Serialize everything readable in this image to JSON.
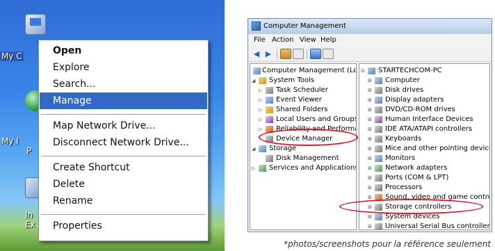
{
  "desktop": {
    "labels": [
      "My C",
      "My I",
      "P",
      "In",
      "Ex"
    ]
  },
  "context_menu": {
    "items": [
      "Open",
      "Explore",
      "Search...",
      "Manage",
      "Map Network Drive...",
      "Disconnect Network Drive...",
      "Create Shortcut",
      "Delete",
      "Rename",
      "Properties"
    ],
    "highlighted": "Manage"
  },
  "cm": {
    "title": "Computer Management",
    "menu": [
      "File",
      "Action",
      "View",
      "Help"
    ],
    "tree": [
      "Computer Management (Local",
      "System Tools",
      "Task Scheduler",
      "Event Viewer",
      "Shared Folders",
      "Local Users and Groups",
      "Reliability and Performa",
      "Device Manager",
      "Storage",
      "Disk Management",
      "Services and Applications"
    ],
    "devices": [
      "STARTECHCOM-PC",
      "Computer",
      "Disk drives",
      "Display adapters",
      "DVD/CD-ROM drives",
      "Human Interface Devices",
      "IDE ATA/ATAPI controllers",
      "Keyboards",
      "Mice and other pointing devices",
      "Monitors",
      "Network adapters",
      "Ports (COM & LPT)",
      "Processors",
      "Sound, video and game controllers",
      "Storage controllers",
      "System devices",
      "Universal Serial Bus controllers"
    ]
  },
  "caption": "*photos/screenshots pour la référence seulement",
  "colors": {
    "menu_highlight": "#316ac5",
    "annotation_red": "#e4122a"
  },
  "icons": {
    "back": "back-arrow-icon",
    "forward": "forward-arrow-icon"
  }
}
